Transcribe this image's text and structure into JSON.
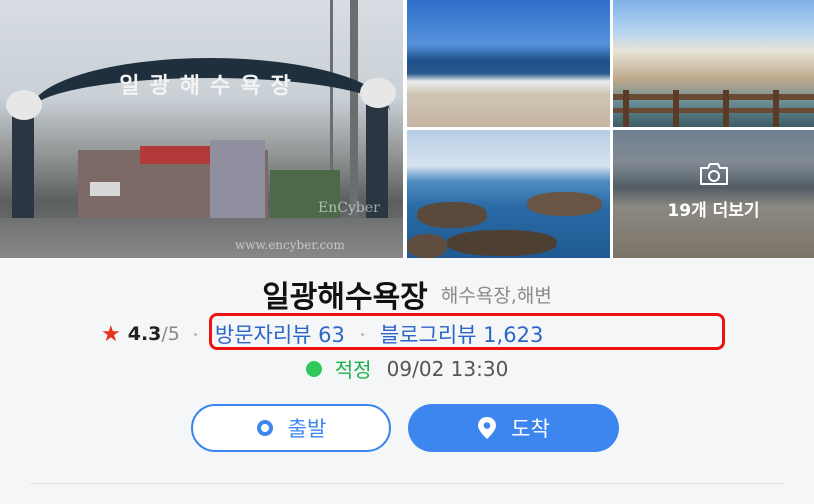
{
  "gallery": {
    "main_photo": {
      "arch_text": "일광해수욕장",
      "watermark_1": "EnCyber",
      "watermark_2": "www.encyber.com"
    },
    "more_photos_label": "19개 더보기"
  },
  "place": {
    "name": "일광해수욕장",
    "category": "해수욕장,해변"
  },
  "rating": {
    "score": "4.3",
    "max": "/5",
    "visitor_reviews": "방문자리뷰 63",
    "blog_reviews": "블로그리뷰 1,623"
  },
  "status": {
    "label": "적정",
    "time": "09/02 13:30"
  },
  "buttons": {
    "depart": "출발",
    "arrive": "도착"
  },
  "colors": {
    "accent": "#3d86f0",
    "star": "#e8321e",
    "status_ok": "#2ec95a",
    "highlight": "#e11111"
  }
}
